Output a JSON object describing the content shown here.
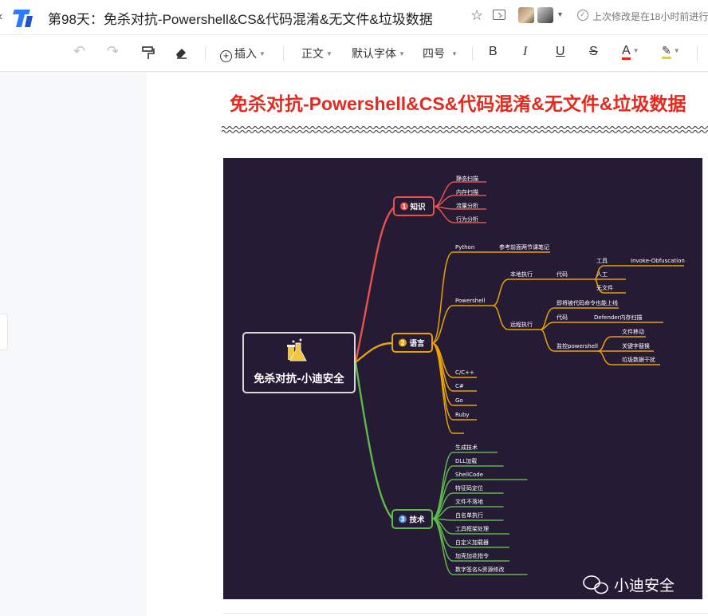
{
  "window": {
    "title": "第98天：免杀对抗-Powershell&CS&代码混淆&无文件&垃圾数据",
    "save_status": "上次修改是在18小时前进行"
  },
  "toolbar": {
    "insert": "插入",
    "style": "正文",
    "font": "默认字体",
    "size": "四号",
    "bold": "B",
    "italic": "I",
    "underline": "U",
    "strike": "S",
    "font_color": "A",
    "font_color_hex": "#e0281c",
    "highlight_hex": "#f5d300"
  },
  "document": {
    "heading": "免杀对抗-Powershell&CS&代码混淆&无文件&垃圾数据",
    "heading_color": "#e22b1e"
  },
  "mindmap": {
    "root": "免杀对抗-小迪安全",
    "watermark": "小迪安全",
    "branches": {
      "knowledge": {
        "label": "知识",
        "badge": "1",
        "color": "#e7524d",
        "leaves": [
          "静态扫描",
          "内存扫描",
          "流量分析",
          "行为分析"
        ]
      },
      "language": {
        "label": "语言",
        "badge": "2",
        "color": "#e9a200",
        "python": "Python",
        "python_note": "参考前面两节课笔记",
        "powershell": "Powershell",
        "local_exec": "本地执行",
        "code": "代码",
        "tool": "工具",
        "invoke": "Invoke-Obfuscation",
        "manual": "人工",
        "fileless": "无文件",
        "remote_exec": "远程执行",
        "remote_load": "即将被代码命令也能上线",
        "code2": "代码",
        "defender": "Defender内存扫描",
        "monitor_ps": "监控powershell",
        "file_move": "文件移动",
        "key_replace": "关键字替换",
        "garbage": "垃圾数据干扰",
        "others": [
          "C/C++",
          "C#",
          "Go",
          "Ruby",
          ""
        ]
      },
      "technique": {
        "label": "技术",
        "badge": "3",
        "color": "#5fb84c",
        "leaves": [
          "生成技术",
          "DLL加载",
          "ShellCode",
          "特征码定位",
          "文件不落地",
          "白名单执行",
          "工具框架处理",
          "白定义加载器",
          "加壳加花指令",
          "数字签名&资源修改"
        ]
      }
    }
  }
}
